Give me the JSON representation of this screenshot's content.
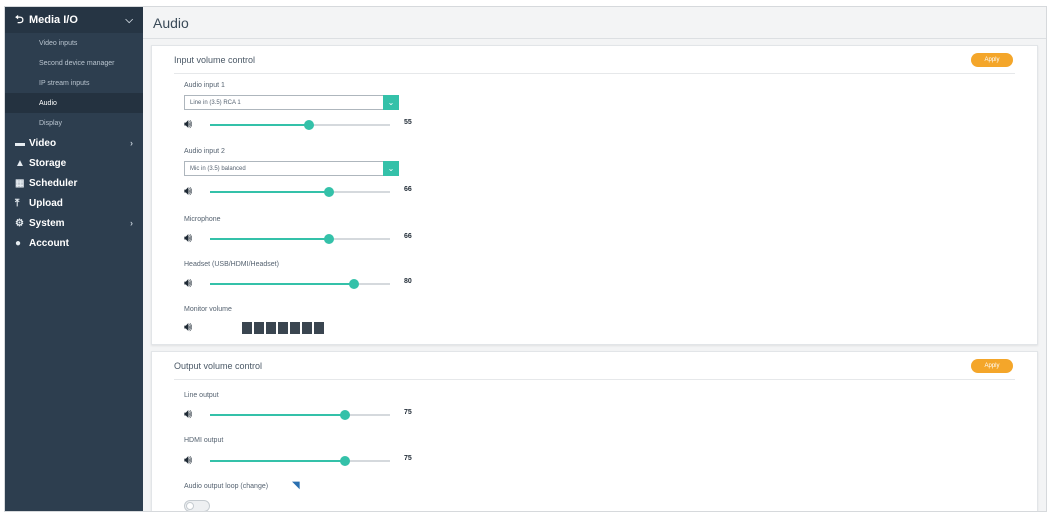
{
  "sidebar": {
    "header": {
      "icon": "back-arrow-icon",
      "label": "Media I/O"
    },
    "sub_items": [
      {
        "label": "Video inputs",
        "active": false
      },
      {
        "label": "Second device manager",
        "active": false
      },
      {
        "label": "IP stream inputs",
        "active": false
      },
      {
        "label": "Audio",
        "active": true
      },
      {
        "label": "Display",
        "active": false
      }
    ],
    "items": [
      {
        "icon": "video-icon",
        "label": "Video",
        "chevron": true
      },
      {
        "icon": "image-icon",
        "label": "Storage",
        "chevron": false
      },
      {
        "icon": "calendar-icon",
        "label": "Scheduler",
        "chevron": false
      },
      {
        "icon": "upload-icon",
        "label": "Upload",
        "chevron": false
      },
      {
        "icon": "system-icon",
        "label": "System",
        "chevron": true
      },
      {
        "icon": "user-icon",
        "label": "Account",
        "chevron": false
      }
    ]
  },
  "page_title": "Audio",
  "input_panel": {
    "title": "Input volume control",
    "save_label": "Apply",
    "audio_input_1": {
      "label": "Audio input 1",
      "select_value": "Line in (3.5) RCA 1",
      "volume": 55
    },
    "audio_input_2": {
      "label": "Audio input 2",
      "select_value": "Mic in (3.5) balanced",
      "volume": 66
    },
    "microphone": {
      "label": "Microphone",
      "volume": 66
    },
    "usb_audio": {
      "label": "Headset (USB/HDMI/Headset)",
      "volume": 80
    },
    "monitor": {
      "label": "Monitor volume",
      "level_segments": 7
    }
  },
  "output_panel": {
    "title": "Output volume control",
    "save_label": "Apply",
    "line_output": {
      "label": "Line output",
      "volume": 75
    },
    "hdmi_output": {
      "label": "HDMI output",
      "volume": 75
    },
    "loop": {
      "label": "Audio output loop (change)",
      "enabled": false
    }
  }
}
